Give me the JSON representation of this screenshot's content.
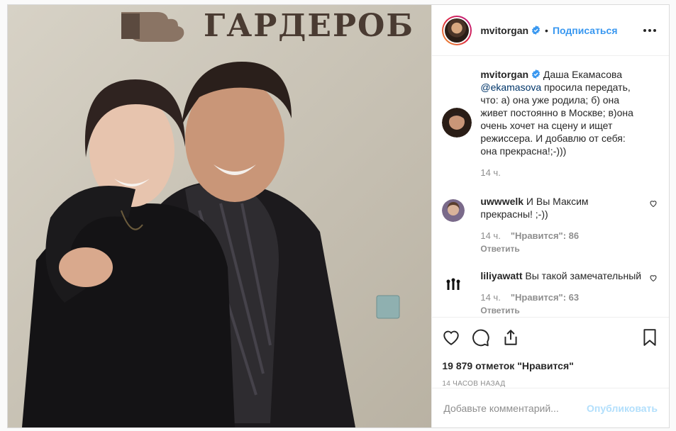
{
  "sign": {
    "text": "ГАРДЕРОБ"
  },
  "header": {
    "username": "mvitorgan",
    "separator": "•",
    "follow_label": "Подписаться"
  },
  "caption": {
    "username": "mvitorgan",
    "text_before": " Даша Екамасова ",
    "mention": "@ekamasova",
    "text_after": " просила передать, что: а) она уже родила; б) она живет постоянно в Москве; в)она очень хочет на сцену и ищет режиссера. И добавлю от себя: она прекрасна!;-)))",
    "time": "14 ч."
  },
  "comments": [
    {
      "username": "uwwwelk",
      "text": " И Вы Максим прекрасны! ;-))",
      "time": "14 ч.",
      "likes": "\"Нравится\": 86",
      "reply": "Ответить"
    },
    {
      "username": "liliyawatt",
      "text": " Вы такой замечательный",
      "time": "14 ч.",
      "likes": "\"Нравится\": 63",
      "reply": "Ответить"
    }
  ],
  "stats": {
    "likes": "19 879 отметок \"Нравится\"",
    "posted": "14 часов назад"
  },
  "composer": {
    "placeholder": "Добавьте комментарий...",
    "publish_label": "Опубликовать"
  },
  "colors": {
    "accent": "#3897f0",
    "publish_disabled": "#b2dffc",
    "muted": "#8e8e8e",
    "verified": "#3897f0"
  },
  "icons": [
    "verified-badge-icon",
    "more-options-icon",
    "heart-icon",
    "comment-icon",
    "share-icon",
    "bookmark-icon"
  ]
}
